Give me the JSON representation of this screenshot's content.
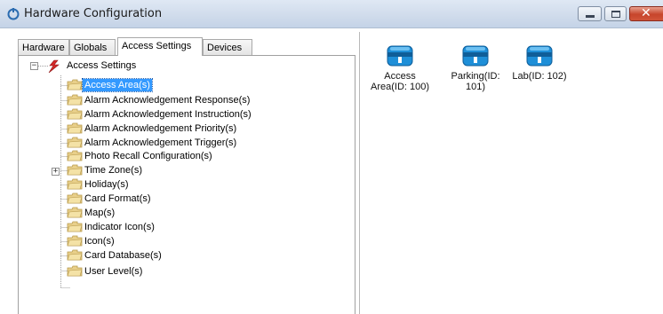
{
  "window": {
    "title": "Hardware Configuration",
    "controls": {
      "minimize": "minimize",
      "maximize": "maximize",
      "close": "✕"
    }
  },
  "tabs": [
    {
      "label": "Hardware",
      "active": false
    },
    {
      "label": "Globals",
      "active": false
    },
    {
      "label": "Access Settings",
      "active": true
    },
    {
      "label": "Devices",
      "active": false
    }
  ],
  "tree": {
    "root": {
      "label": "Access Settings",
      "expander": "−"
    },
    "items": [
      {
        "label": "Access Area(s)",
        "selected": true
      },
      {
        "label": "Alarm Acknowledgement Response(s)"
      },
      {
        "label": "Alarm Acknowledgement Instruction(s)"
      },
      {
        "label": "Alarm Acknowledgement Priority(s)"
      },
      {
        "label": "Alarm Acknowledgement Trigger(s)"
      },
      {
        "label": "Photo Recall Configuration(s)"
      },
      {
        "label": "Time Zone(s)",
        "expander": "+"
      },
      {
        "label": "Holiday(s)"
      },
      {
        "label": "Card Format(s)"
      },
      {
        "label": "Map(s)"
      },
      {
        "label": "Indicator Icon(s)"
      },
      {
        "label": "Icon(s)"
      },
      {
        "label": "Card Database(s)"
      },
      {
        "label": "User Level(s)"
      }
    ]
  },
  "devices": [
    {
      "line1": "Access",
      "line2": "Area(ID: 100)"
    },
    {
      "line1": "Parking(ID:",
      "line2": "101)"
    },
    {
      "line1": "Lab(ID: 102)",
      "line2": ""
    }
  ],
  "colors": {
    "selection": "#3399ff",
    "device_icon": "#1e8fd8",
    "folder": "#e8cf8a"
  }
}
